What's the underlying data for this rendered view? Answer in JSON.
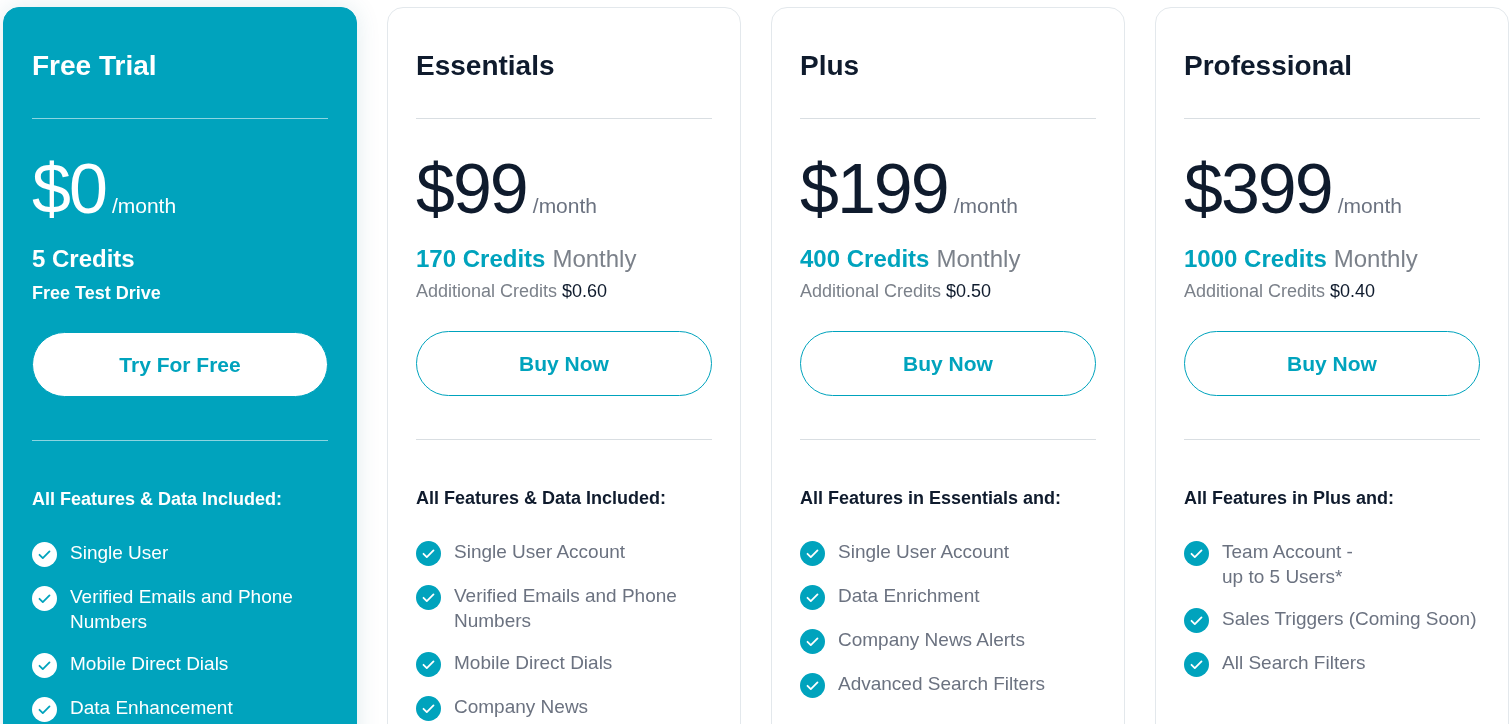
{
  "plans": [
    {
      "kind": "trial",
      "featured": true,
      "name": "Free Trial",
      "price": "$0",
      "period": "/month",
      "credits": "5 Credits",
      "note": "Free Test Drive",
      "button": "Try For Free",
      "features_heading": "All Features & Data Included:",
      "features": [
        "Single User",
        "Verified Emails and Phone Numbers",
        "Mobile Direct Dials",
        "Data Enhancement"
      ]
    },
    {
      "kind": "paid",
      "featured": false,
      "name": "Essentials",
      "price": "$99",
      "period": "/month",
      "credits": "170 Credits",
      "credits_period": "Monthly",
      "extra_label": "Additional Credits",
      "extra_price": "$0.60",
      "button": "Buy Now",
      "features_heading": "All Features & Data Included:",
      "features": [
        "Single User Account",
        "Verified Emails and Phone Numbers",
        "Mobile Direct Dials",
        "Company News"
      ]
    },
    {
      "kind": "paid",
      "featured": false,
      "name": "Plus",
      "price": "$199",
      "period": "/month",
      "credits": "400 Credits",
      "credits_period": "Monthly",
      "extra_label": "Additional Credits",
      "extra_price": "$0.50",
      "button": "Buy Now",
      "features_heading": "All Features in Essentials and:",
      "features": [
        "Single User Account",
        "Data Enrichment",
        "Company News Alerts",
        "Advanced Search Filters"
      ]
    },
    {
      "kind": "paid",
      "featured": false,
      "name": "Professional",
      "price": "$399",
      "period": "/month",
      "credits": "1000 Credits",
      "credits_period": "Monthly",
      "extra_label": "Additional Credits",
      "extra_price": "$0.40",
      "button": "Buy Now",
      "features_heading": "All Features in Plus and:",
      "features": [
        "Team Account -\nup to 5 Users*",
        "Sales Triggers (Coming Soon)",
        "All Search Filters"
      ]
    }
  ]
}
